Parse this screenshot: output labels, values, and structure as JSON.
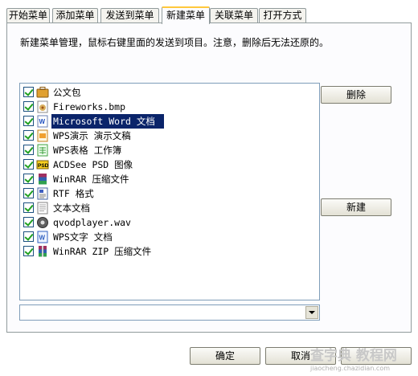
{
  "tabs": [
    {
      "label": "开始菜单",
      "active": false
    },
    {
      "label": "添加菜单",
      "active": false
    },
    {
      "label": "发送到菜单",
      "active": false
    },
    {
      "label": "新建菜单",
      "active": true
    },
    {
      "label": "关联菜单",
      "active": false
    },
    {
      "label": "打开方式",
      "active": false
    }
  ],
  "description": "新建菜单管理，鼠标右键里面的发送到项目。注意，删除后无法还原的。",
  "list": {
    "items": [
      {
        "label": "公文包",
        "checked": true,
        "icon": "briefcase-icon"
      },
      {
        "label": "Fireworks.bmp",
        "checked": true,
        "icon": "fireworks-bmp-icon"
      },
      {
        "label": "Microsoft Word 文档",
        "checked": true,
        "icon": "word-document-icon",
        "selected": true
      },
      {
        "label": "WPS演示 演示文稿",
        "checked": true,
        "icon": "wps-presentation-icon"
      },
      {
        "label": "WPS表格 工作簿",
        "checked": true,
        "icon": "wps-spreadsheet-icon"
      },
      {
        "label": "ACDSee PSD 图像",
        "checked": true,
        "icon": "psd-image-icon"
      },
      {
        "label": "WinRAR 压缩文件",
        "checked": true,
        "icon": "winrar-archive-icon"
      },
      {
        "label": "RTF 格式",
        "checked": true,
        "icon": "rtf-document-icon"
      },
      {
        "label": "文本文档",
        "checked": true,
        "icon": "text-document-icon"
      },
      {
        "label": "qvodplayer.wav",
        "checked": true,
        "icon": "qvod-audio-icon"
      },
      {
        "label": "WPS文字 文档",
        "checked": true,
        "icon": "wps-writer-icon"
      },
      {
        "label": "WinRAR ZIP 压缩文件",
        "checked": true,
        "icon": "winrar-zip-icon"
      }
    ]
  },
  "buttons": {
    "delete": "删除",
    "new": "新建",
    "ok": "确定",
    "cancel": "取消"
  },
  "combo": {
    "value": ""
  },
  "watermark": {
    "main": "查字典 教程网",
    "sub": "jiaocheng.chazidian.com"
  },
  "colors": {
    "selection": "#0a246a",
    "active_tab_accent": "#ffc83c",
    "check_mark": "#21a121"
  }
}
